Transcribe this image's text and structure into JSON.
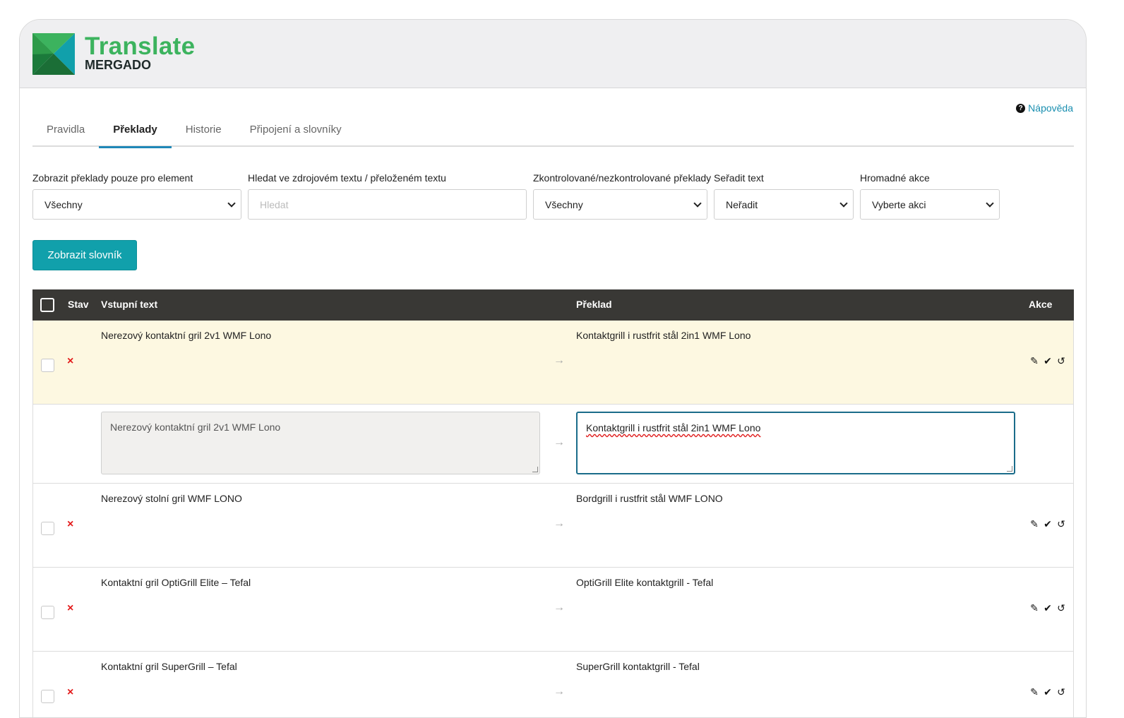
{
  "brand": {
    "title": "Translate",
    "subtitle": "MERGADO",
    "colors": {
      "green": "#3cb35e",
      "teal": "#11a0ab",
      "dark_green": "#1b7a3b"
    }
  },
  "help": {
    "label": "Nápověda",
    "icon": "question-circle-icon"
  },
  "tabs": [
    {
      "label": "Pravidla",
      "active": false
    },
    {
      "label": "Překlady",
      "active": true
    },
    {
      "label": "Historie",
      "active": false
    },
    {
      "label": "Připojení a slovníky",
      "active": false
    }
  ],
  "filters": {
    "element": {
      "label": "Zobrazit překlady pouze pro element",
      "value": "Všechny"
    },
    "search": {
      "label": "Hledat ve zdrojovém textu / přeloženém textu",
      "placeholder": "Hledat",
      "value": ""
    },
    "checked": {
      "label": "Zkontrolované/nezkontrolované překlady",
      "value": "Všechny"
    },
    "sort": {
      "label": "Seřadit text",
      "value": "Neřadit"
    },
    "bulk": {
      "label": "Hromadné akce",
      "value": "Vyberte akci"
    }
  },
  "dictionary_button": "Zobrazit slovník",
  "table": {
    "headers": {
      "status": "Stav",
      "source": "Vstupní text",
      "translation": "Překlad",
      "actions": "Akce"
    },
    "rows": [
      {
        "source": "Nerezový kontaktní gril 2v1 WMF Lono",
        "translation": "Kontaktgrill i rustfrit stål 2in1 WMF Lono",
        "status": "×"
      },
      {
        "source": "Nerezový stolní gril WMF LONO",
        "translation": "Bordgrill i rustfrit stål WMF LONO",
        "status": "×"
      },
      {
        "source": "Kontaktní gril OptiGrill Elite – Tefal",
        "translation": "OptiGrill Elite kontaktgrill - Tefal",
        "status": "×"
      },
      {
        "source": "Kontaktní gril SuperGrill – Tefal",
        "translation": "SuperGrill kontaktgrill - Tefal",
        "status": "×"
      }
    ],
    "editor": {
      "source": "Nerezový kontaktní gril 2v1 WMF Lono",
      "translation": "Kontaktgrill i rustfrit stål 2in1 WMF Lono"
    }
  }
}
